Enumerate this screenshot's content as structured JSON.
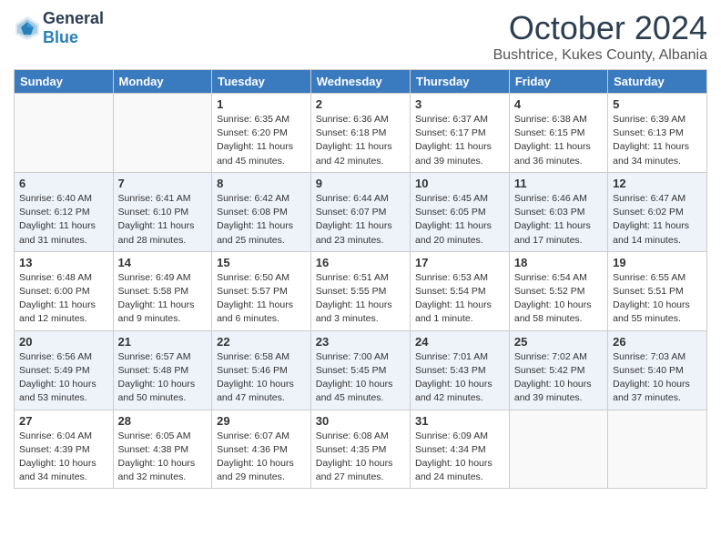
{
  "header": {
    "logo_general": "General",
    "logo_blue": "Blue",
    "month_title": "October 2024",
    "location": "Bushtrice, Kukes County, Albania"
  },
  "days_of_week": [
    "Sunday",
    "Monday",
    "Tuesday",
    "Wednesday",
    "Thursday",
    "Friday",
    "Saturday"
  ],
  "weeks": [
    [
      {
        "day": "",
        "info": ""
      },
      {
        "day": "",
        "info": ""
      },
      {
        "day": "1",
        "info": "Sunrise: 6:35 AM\nSunset: 6:20 PM\nDaylight: 11 hours and 45 minutes."
      },
      {
        "day": "2",
        "info": "Sunrise: 6:36 AM\nSunset: 6:18 PM\nDaylight: 11 hours and 42 minutes."
      },
      {
        "day": "3",
        "info": "Sunrise: 6:37 AM\nSunset: 6:17 PM\nDaylight: 11 hours and 39 minutes."
      },
      {
        "day": "4",
        "info": "Sunrise: 6:38 AM\nSunset: 6:15 PM\nDaylight: 11 hours and 36 minutes."
      },
      {
        "day": "5",
        "info": "Sunrise: 6:39 AM\nSunset: 6:13 PM\nDaylight: 11 hours and 34 minutes."
      }
    ],
    [
      {
        "day": "6",
        "info": "Sunrise: 6:40 AM\nSunset: 6:12 PM\nDaylight: 11 hours and 31 minutes."
      },
      {
        "day": "7",
        "info": "Sunrise: 6:41 AM\nSunset: 6:10 PM\nDaylight: 11 hours and 28 minutes."
      },
      {
        "day": "8",
        "info": "Sunrise: 6:42 AM\nSunset: 6:08 PM\nDaylight: 11 hours and 25 minutes."
      },
      {
        "day": "9",
        "info": "Sunrise: 6:44 AM\nSunset: 6:07 PM\nDaylight: 11 hours and 23 minutes."
      },
      {
        "day": "10",
        "info": "Sunrise: 6:45 AM\nSunset: 6:05 PM\nDaylight: 11 hours and 20 minutes."
      },
      {
        "day": "11",
        "info": "Sunrise: 6:46 AM\nSunset: 6:03 PM\nDaylight: 11 hours and 17 minutes."
      },
      {
        "day": "12",
        "info": "Sunrise: 6:47 AM\nSunset: 6:02 PM\nDaylight: 11 hours and 14 minutes."
      }
    ],
    [
      {
        "day": "13",
        "info": "Sunrise: 6:48 AM\nSunset: 6:00 PM\nDaylight: 11 hours and 12 minutes."
      },
      {
        "day": "14",
        "info": "Sunrise: 6:49 AM\nSunset: 5:58 PM\nDaylight: 11 hours and 9 minutes."
      },
      {
        "day": "15",
        "info": "Sunrise: 6:50 AM\nSunset: 5:57 PM\nDaylight: 11 hours and 6 minutes."
      },
      {
        "day": "16",
        "info": "Sunrise: 6:51 AM\nSunset: 5:55 PM\nDaylight: 11 hours and 3 minutes."
      },
      {
        "day": "17",
        "info": "Sunrise: 6:53 AM\nSunset: 5:54 PM\nDaylight: 11 hours and 1 minute."
      },
      {
        "day": "18",
        "info": "Sunrise: 6:54 AM\nSunset: 5:52 PM\nDaylight: 10 hours and 58 minutes."
      },
      {
        "day": "19",
        "info": "Sunrise: 6:55 AM\nSunset: 5:51 PM\nDaylight: 10 hours and 55 minutes."
      }
    ],
    [
      {
        "day": "20",
        "info": "Sunrise: 6:56 AM\nSunset: 5:49 PM\nDaylight: 10 hours and 53 minutes."
      },
      {
        "day": "21",
        "info": "Sunrise: 6:57 AM\nSunset: 5:48 PM\nDaylight: 10 hours and 50 minutes."
      },
      {
        "day": "22",
        "info": "Sunrise: 6:58 AM\nSunset: 5:46 PM\nDaylight: 10 hours and 47 minutes."
      },
      {
        "day": "23",
        "info": "Sunrise: 7:00 AM\nSunset: 5:45 PM\nDaylight: 10 hours and 45 minutes."
      },
      {
        "day": "24",
        "info": "Sunrise: 7:01 AM\nSunset: 5:43 PM\nDaylight: 10 hours and 42 minutes."
      },
      {
        "day": "25",
        "info": "Sunrise: 7:02 AM\nSunset: 5:42 PM\nDaylight: 10 hours and 39 minutes."
      },
      {
        "day": "26",
        "info": "Sunrise: 7:03 AM\nSunset: 5:40 PM\nDaylight: 10 hours and 37 minutes."
      }
    ],
    [
      {
        "day": "27",
        "info": "Sunrise: 6:04 AM\nSunset: 4:39 PM\nDaylight: 10 hours and 34 minutes."
      },
      {
        "day": "28",
        "info": "Sunrise: 6:05 AM\nSunset: 4:38 PM\nDaylight: 10 hours and 32 minutes."
      },
      {
        "day": "29",
        "info": "Sunrise: 6:07 AM\nSunset: 4:36 PM\nDaylight: 10 hours and 29 minutes."
      },
      {
        "day": "30",
        "info": "Sunrise: 6:08 AM\nSunset: 4:35 PM\nDaylight: 10 hours and 27 minutes."
      },
      {
        "day": "31",
        "info": "Sunrise: 6:09 AM\nSunset: 4:34 PM\nDaylight: 10 hours and 24 minutes."
      },
      {
        "day": "",
        "info": ""
      },
      {
        "day": "",
        "info": ""
      }
    ]
  ]
}
